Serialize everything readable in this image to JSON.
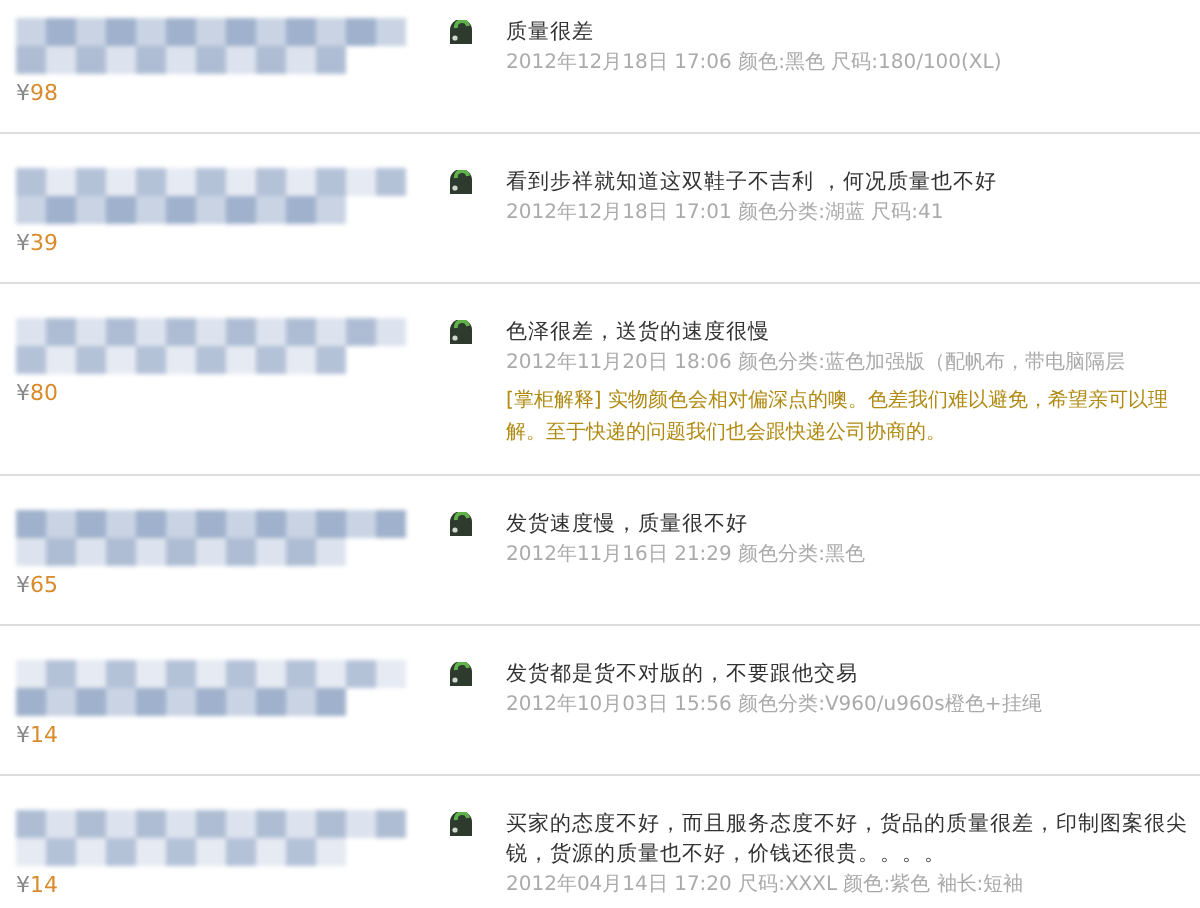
{
  "reviews": [
    {
      "price_symbol": "¥",
      "price": "98",
      "comment": "质量很差",
      "meta": "2012年12月18日 17:06 颜色:黑色  尺码:180/100(XL)"
    },
    {
      "price_symbol": "¥",
      "price": "39",
      "comment": "看到步祥就知道这双鞋子不吉利 ，何况质量也不好",
      "meta": "2012年12月18日 17:01 颜色分类:湖蓝  尺码:41"
    },
    {
      "price_symbol": "¥",
      "price": "80",
      "comment": "色泽很差，送货的速度很慢",
      "meta": "2012年11月20日 18:06 颜色分类:蓝色加强版（配帆布，带电脑隔层",
      "reply": "[掌柜解释] 实物颜色会相对偏深点的噢。色差我们难以避免，希望亲可以理解。至于快递的问题我们也会跟快递公司协商的。"
    },
    {
      "price_symbol": "¥",
      "price": "65",
      "comment": "发货速度慢，质量很不好",
      "meta": "2012年11月16日 21:29 颜色分类:黑色"
    },
    {
      "price_symbol": "¥",
      "price": "14",
      "comment": "发货都是货不对版的，不要跟他交易",
      "meta": "2012年10月03日 15:56 颜色分类:V960/u960s橙色+挂绳"
    },
    {
      "price_symbol": "¥",
      "price": "14",
      "comment": "买家的态度不好，而且服务态度不好，货品的质量很差，印制图案很尖锐，货源的质量也不好，价钱还很贵。。。。",
      "meta": "2012年04月14日 17:20 尺码:XXXL  颜色:紫色  袖长:短袖"
    }
  ]
}
